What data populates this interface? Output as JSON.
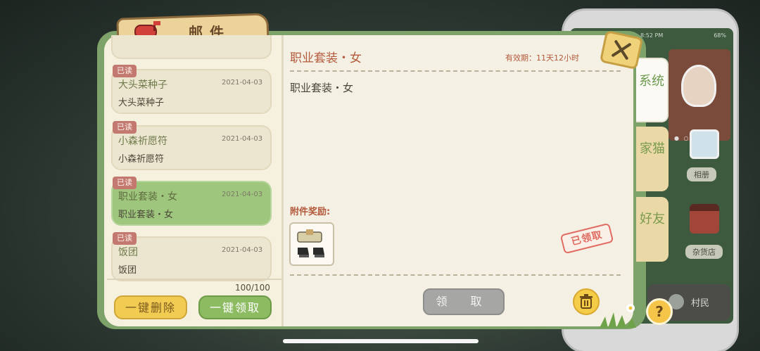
{
  "window": {
    "title": "邮件"
  },
  "mail_list": {
    "items": [
      {
        "status": "已读",
        "title": "大头菜种子",
        "date": "2021-04-03",
        "body": "大头菜种子",
        "selected": false
      },
      {
        "status": "已读",
        "title": "小森祈愿符",
        "date": "2021-04-03",
        "body": "小森祈愿符",
        "selected": false
      },
      {
        "status": "已读",
        "title": "职业套装・女",
        "date": "2021-04-03",
        "body": "职业套装・女",
        "selected": true
      },
      {
        "status": "已读",
        "title": "饭团",
        "date": "2021-04-03",
        "body": "饭团",
        "selected": false
      }
    ],
    "count": "100/100",
    "delete_all_label": "一键删除",
    "claim_all_label": "一键领取"
  },
  "detail": {
    "heading": "职业套装・女",
    "validity": "有效期：11天12小时",
    "content": "职业套装・女",
    "attachments_label": "附件奖励:",
    "attachment_icon": "shoes-and-outfit-icon",
    "claimed_stamp": "已领取",
    "claim_label": "领 取",
    "claim_enabled": false
  },
  "tabs": [
    {
      "label": "系统",
      "active": true
    },
    {
      "label": "家猫",
      "active": false
    },
    {
      "label": "好友",
      "active": false
    }
  ],
  "background_phone": {
    "time": "8:52 PM",
    "battery": "68%",
    "album_label": "相册",
    "store_label": "杂货店",
    "villager_label": "村民"
  },
  "help_label": "?",
  "colors": {
    "panel_green": "#7ea36a",
    "paper": "#f4f0e3",
    "accent_red": "#b45a3c",
    "selected_card": "#9ec77d",
    "stamp_red": "#e06c62"
  }
}
